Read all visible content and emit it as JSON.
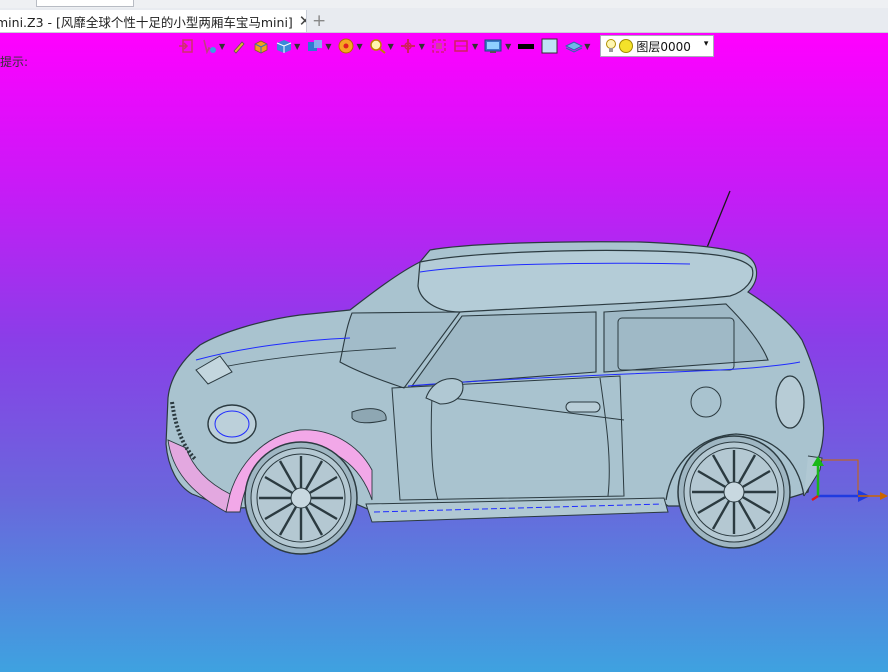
{
  "tabs": [
    {
      "label": "mini.Z3 - [风靡全球个性十足的小型两厢车宝马mini]",
      "active": true
    }
  ],
  "tab_add_label": "+",
  "tab_close_label": "✕",
  "viewport": {
    "prompt_text": "提示:",
    "background_top": "#ff00ff",
    "background_bottom": "#3ea2e0"
  },
  "toolbar": {
    "layer_name": "图层0000",
    "layer_dropdown_arrow": "▾",
    "icons": [
      "exit-icon",
      "select-filter-icon",
      "sketch-pen-icon",
      "solid-box-icon",
      "shaded-cube-icon",
      "view-orient-icon",
      "render-wheel-icon",
      "zoom-icon",
      "crosshair-icon",
      "zoom-fit-icon",
      "frame-icon",
      "display-icon",
      "black-color-swatch",
      "color-swatch",
      "layer-stack-icon"
    ]
  },
  "model": {
    "body_color": "#a9c3cf",
    "edge_color": "#2b3a40",
    "seam_color": "#1f2bff",
    "fender_color": "#f2a8e8"
  }
}
